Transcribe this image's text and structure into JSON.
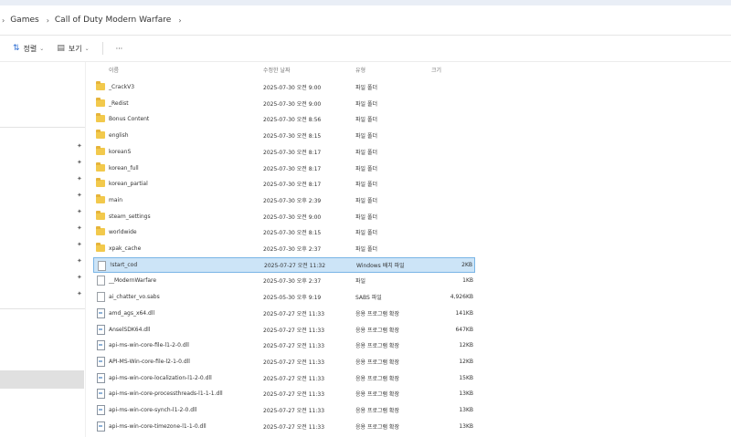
{
  "breadcrumb": [
    "Games",
    "Call of Duty Modern Warfare"
  ],
  "toolbar": {
    "sort_label": "정렬",
    "view_label": "보기",
    "more_label": "···"
  },
  "columns": {
    "name": "이름",
    "date": "수정한 날짜",
    "type": "유형",
    "size": "크기"
  },
  "files": [
    {
      "name": "_CrackV3",
      "date": "2025-07-30 오전 9:00",
      "type": "파일 폴더",
      "size": "",
      "kind": "folder"
    },
    {
      "name": "_Redist",
      "date": "2025-07-30 오전 9:00",
      "type": "파일 폴더",
      "size": "",
      "kind": "folder"
    },
    {
      "name": "Bonus Content",
      "date": "2025-07-30 오전 8:56",
      "type": "파일 폴더",
      "size": "",
      "kind": "folder"
    },
    {
      "name": "english",
      "date": "2025-07-30 오전 8:15",
      "type": "파일 폴더",
      "size": "",
      "kind": "folder"
    },
    {
      "name": "koreanS",
      "date": "2025-07-30 오전 8:17",
      "type": "파일 폴더",
      "size": "",
      "kind": "folder"
    },
    {
      "name": "korean_full",
      "date": "2025-07-30 오전 8:17",
      "type": "파일 폴더",
      "size": "",
      "kind": "folder"
    },
    {
      "name": "korean_partial",
      "date": "2025-07-30 오전 8:17",
      "type": "파일 폴더",
      "size": "",
      "kind": "folder"
    },
    {
      "name": "main",
      "date": "2025-07-30 오후 2:39",
      "type": "파일 폴더",
      "size": "",
      "kind": "folder"
    },
    {
      "name": "steam_settings",
      "date": "2025-07-30 오전 9:00",
      "type": "파일 폴더",
      "size": "",
      "kind": "folder"
    },
    {
      "name": "worldwide",
      "date": "2025-07-30 오전 8:15",
      "type": "파일 폴더",
      "size": "",
      "kind": "folder"
    },
    {
      "name": "xpak_cache",
      "date": "2025-07-30 오후 2:37",
      "type": "파일 폴더",
      "size": "",
      "kind": "folder"
    },
    {
      "name": "!start_cod",
      "date": "2025-07-27 오전 11:32",
      "type": "Windows 배치 파일",
      "size": "2KB",
      "kind": "file",
      "selected": true
    },
    {
      "name": "__ModernWarfare",
      "date": "2025-07-30 오후 2:37",
      "type": "파일",
      "size": "1KB",
      "kind": "file"
    },
    {
      "name": "ai_chatter_vo.sabs",
      "date": "2025-05-30 오후 9:19",
      "type": "SABS 파일",
      "size": "4,926KB",
      "kind": "file"
    },
    {
      "name": "amd_ags_x64.dll",
      "date": "2025-07-27 오전 11:33",
      "type": "응용 프로그램 확장",
      "size": "141KB",
      "kind": "dll"
    },
    {
      "name": "AnselSDK64.dll",
      "date": "2025-07-27 오전 11:33",
      "type": "응용 프로그램 확장",
      "size": "647KB",
      "kind": "dll"
    },
    {
      "name": "api-ms-win-core-file-l1-2-0.dll",
      "date": "2025-07-27 오전 11:33",
      "type": "응용 프로그램 확장",
      "size": "12KB",
      "kind": "dll"
    },
    {
      "name": "API-MS-Win-core-file-l2-1-0.dll",
      "date": "2025-07-27 오전 11:33",
      "type": "응용 프로그램 확장",
      "size": "12KB",
      "kind": "dll"
    },
    {
      "name": "api-ms-win-core-localization-l1-2-0.dll",
      "date": "2025-07-27 오전 11:33",
      "type": "응용 프로그램 확장",
      "size": "15KB",
      "kind": "dll"
    },
    {
      "name": "api-ms-win-core-processthreads-l1-1-1.dll",
      "date": "2025-07-27 오전 11:33",
      "type": "응용 프로그램 확장",
      "size": "13KB",
      "kind": "dll"
    },
    {
      "name": "api-ms-win-core-synch-l1-2-0.dll",
      "date": "2025-07-27 오전 11:33",
      "type": "응용 프로그램 확장",
      "size": "13KB",
      "kind": "dll"
    },
    {
      "name": "api-ms-win-core-timezone-l1-1-0.dll",
      "date": "2025-07-27 오전 11:33",
      "type": "응용 프로그램 확장",
      "size": "13KB",
      "kind": "dll"
    }
  ]
}
